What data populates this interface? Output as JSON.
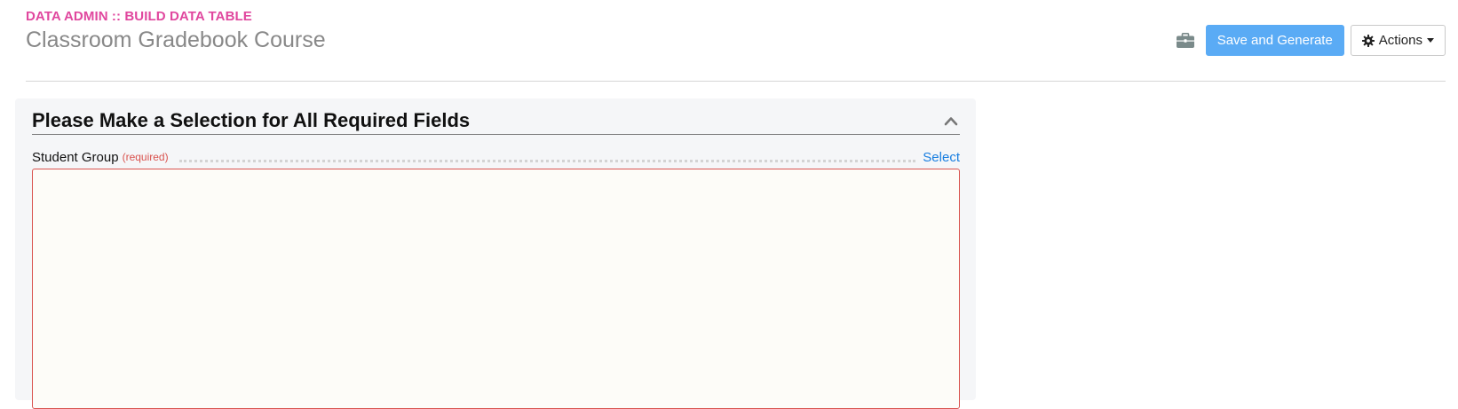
{
  "header": {
    "breadcrumb": "DATA ADMIN :: BUILD DATA TABLE",
    "title": "Classroom Gradebook Course"
  },
  "toolbar": {
    "briefcase_icon": "briefcase-icon",
    "save_label": "Save and Generate",
    "actions_label": "Actions",
    "actions_icon": "gear-icon",
    "primary_color": "#5aabf5"
  },
  "panel": {
    "title": "Please Make a Selection for All Required Fields",
    "collapse_icon": "chevron-up-icon",
    "fields": [
      {
        "label": "Student Group",
        "required_text": "(required)",
        "action_label": "Select",
        "value": ""
      }
    ]
  },
  "colors": {
    "breadcrumb": "#e0479e",
    "required": "#d9534f",
    "link": "#1a7fe0"
  }
}
